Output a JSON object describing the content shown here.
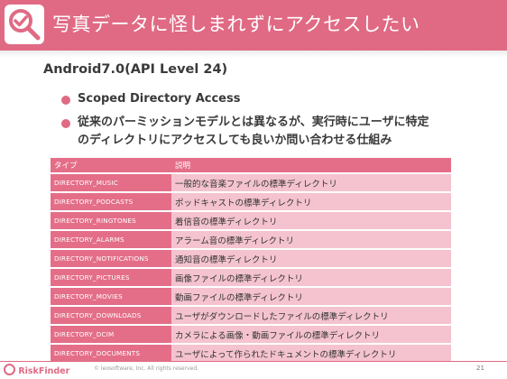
{
  "header": {
    "title": "写真データに怪しまれずにアクセスしたい",
    "accent": "#e06a84",
    "logo_icon": "magnifier-check-icon"
  },
  "subtitle": "Android7.0(API Level 24)",
  "bullets": [
    {
      "text": "Scoped Directory Access"
    },
    {
      "line1": "従来のパーミッションモデルとは異なるが、実行時にユーザに特定",
      "line2": "のディレクトリにアクセスしても良いか問い合わせる仕組み"
    }
  ],
  "table": {
    "headers": [
      "タイプ",
      "説明"
    ],
    "rows": [
      {
        "type": "DIRECTORY_MUSIC",
        "desc": "一般的な音楽ファイルの標準ディレクトリ"
      },
      {
        "type": "DIRECTORY_PODCASTS",
        "desc": "ポッドキャストの標準ディレクトリ"
      },
      {
        "type": "DIRECTORY_RINGTONES",
        "desc": "着信音の標準ディレクトリ"
      },
      {
        "type": "DIRECTORY_ALARMS",
        "desc": "アラーム音の標準ディレクトリ"
      },
      {
        "type": "DIRECTORY_NOTIFICATIONS",
        "desc": "通知音の標準ディレクトリ"
      },
      {
        "type": "DIRECTORY_PICTURES",
        "desc": "画像ファイルの標準ディレクトリ"
      },
      {
        "type": "DIRECTORY_MOVIES",
        "desc": "動画ファイルの標準ディレクトリ"
      },
      {
        "type": "DIRECTORY_DOWNLOADS",
        "desc": "ユーザがダウンロードしたファイルの標準ディレクトリ"
      },
      {
        "type": "DIRECTORY_DCIM",
        "desc": "カメラによる画像・動画ファイルの標準ディレクトリ"
      },
      {
        "type": "DIRECTORY_DOCUMENTS",
        "desc": "ユーザによって作られたドキュメントの標準ディレクトリ"
      }
    ]
  },
  "footer": {
    "brand": "RiskFinder",
    "copyright": "© Ieosoftware, Inc. All rights reserved.",
    "page": "21"
  }
}
